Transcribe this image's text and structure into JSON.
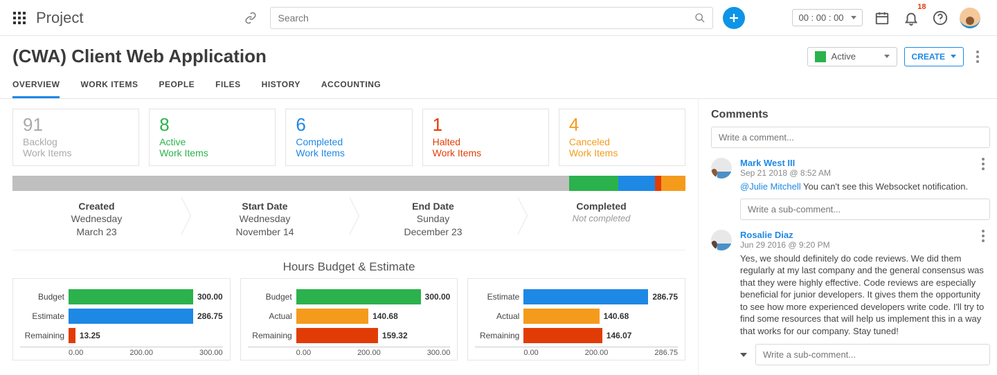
{
  "brand": "Project",
  "search_placeholder": "Search",
  "timer_value": "00 : 00 : 00",
  "notif_count": "18",
  "project_title": "(CWA) Client Web Application",
  "status_label": "Active",
  "create_label": "CREATE",
  "tabs": [
    "OVERVIEW",
    "WORK ITEMS",
    "PEOPLE",
    "FILES",
    "HISTORY",
    "ACCOUNTING"
  ],
  "summary": [
    {
      "count": "91",
      "l1": "Backlog",
      "l2": "Work Items",
      "color": "c-grey"
    },
    {
      "count": "8",
      "l1": "Active",
      "l2": "Work Items",
      "color": "c-green"
    },
    {
      "count": "6",
      "l1": "Completed",
      "l2": "Work Items",
      "color": "c-blue"
    },
    {
      "count": "1",
      "l1": "Halted",
      "l2": "Work Items",
      "color": "c-red"
    },
    {
      "count": "4",
      "l1": "Canceled",
      "l2": "Work Items",
      "color": "c-orange"
    }
  ],
  "timeline": {
    "created": {
      "h": "Created",
      "d1": "Wednesday",
      "d2": "March 23"
    },
    "start": {
      "h": "Start Date",
      "d1": "Wednesday",
      "d2": "November 14"
    },
    "end": {
      "h": "End Date",
      "d1": "Sunday",
      "d2": "December 23"
    },
    "completed": {
      "h": "Completed",
      "nc": "Not completed"
    }
  },
  "charts_title": "Hours Budget & Estimate",
  "chart_data": [
    {
      "type": "bar",
      "orientation": "horizontal",
      "categories": [
        "Budget",
        "Estimate",
        "Remaining"
      ],
      "values": [
        300.0,
        286.75,
        13.25
      ],
      "colors": [
        "#2bb24c",
        "#1e88e5",
        "#e23c06"
      ],
      "xlim": [
        0,
        300
      ],
      "ticks": [
        "0.00",
        "200.00",
        "300.00"
      ]
    },
    {
      "type": "bar",
      "orientation": "horizontal",
      "categories": [
        "Budget",
        "Actual",
        "Remaining"
      ],
      "values": [
        300.0,
        140.68,
        159.32
      ],
      "colors": [
        "#2bb24c",
        "#f59b1c",
        "#e23c06"
      ],
      "xlim": [
        0,
        300
      ],
      "ticks": [
        "0.00",
        "200.00",
        "300.00"
      ]
    },
    {
      "type": "bar",
      "orientation": "horizontal",
      "categories": [
        "Estimate",
        "Actual",
        "Remaining"
      ],
      "values": [
        286.75,
        140.68,
        146.07
      ],
      "colors": [
        "#1e88e5",
        "#f59b1c",
        "#e23c06"
      ],
      "xlim": [
        0,
        286.75
      ],
      "ticks": [
        "0.00",
        "200.00",
        "286.75"
      ]
    }
  ],
  "comments_header": "Comments",
  "comment_placeholder": "Write a comment...",
  "sub_placeholder": "Write a sub-comment...",
  "comments": [
    {
      "name": "Mark West III",
      "date": "Sep 21 2018 @ 8:52 AM",
      "mention": "@Julie Mitchell",
      "text": " You can't see this Websocket notification."
    },
    {
      "name": "Rosalie Diaz",
      "date": "Jun 29 2016 @ 9:20 PM",
      "text": "Yes, we should definitely do code reviews. We did them regularly at my last company and the general consensus was that they were highly effective. Code reviews are especially beneficial for junior developers. It gives them the opportunity to see how more experienced developers write code. I'll try to find some resources that will help us implement this in a way that works for our company. Stay tuned!"
    }
  ]
}
